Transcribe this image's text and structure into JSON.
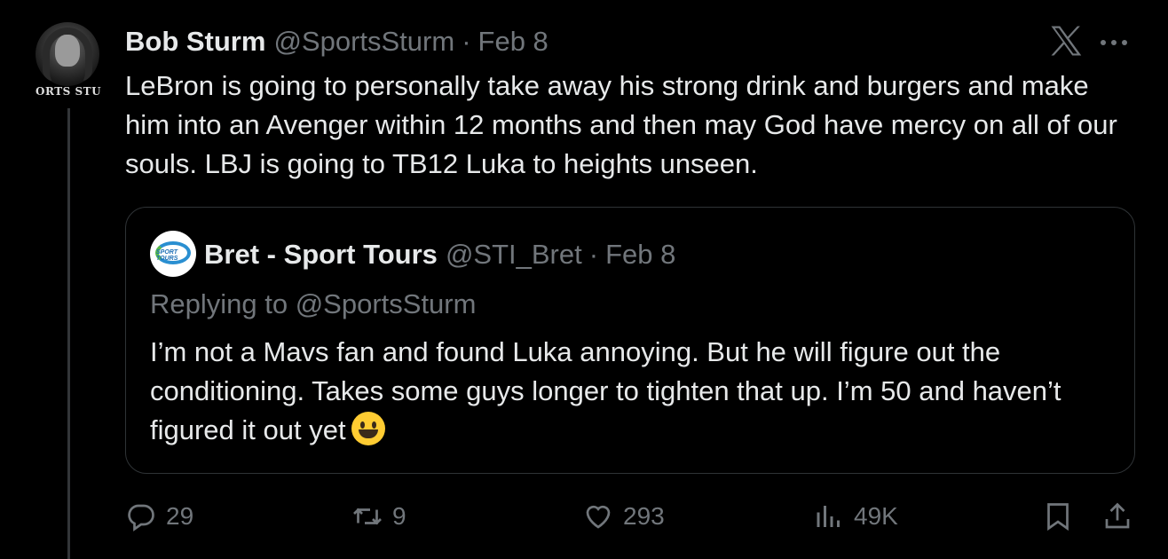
{
  "author": {
    "name": "Bob Sturm",
    "handle": "@SportsSturm",
    "separator": "·",
    "date": "Feb 8",
    "avatar_caption": "ORTS STU"
  },
  "tweet": {
    "text": "LeBron is going to personally take away his strong drink and burgers and make him into an Avenger within 12 months and then may God have mercy on all of our souls. LBJ is going to TB12 Luka to heights unseen."
  },
  "quote": {
    "name": "Bret - Sport Tours",
    "handle": "@STI_Bret",
    "separator": "·",
    "date": "Feb 8",
    "replying_to": "Replying to @SportsSturm",
    "text": "I’m not a Mavs fan and found Luka annoying. But he will figure out the conditioning. Takes some guys longer to tighten that up. I’m 50 and haven’t figured it out yet",
    "avatar_logo_text": "SPORT TOURS"
  },
  "actions": {
    "replies": "29",
    "retweets": "9",
    "likes": "293",
    "views": "49K"
  },
  "icons": [
    "x-logo-icon",
    "more-icon",
    "reply-icon",
    "retweet-icon",
    "like-icon",
    "views-icon",
    "bookmark-icon",
    "share-icon",
    "grinning-face-emoji"
  ],
  "colors": {
    "background": "#000000",
    "text": "#e7e9ea",
    "muted": "#71767b",
    "border": "#2f3336"
  }
}
